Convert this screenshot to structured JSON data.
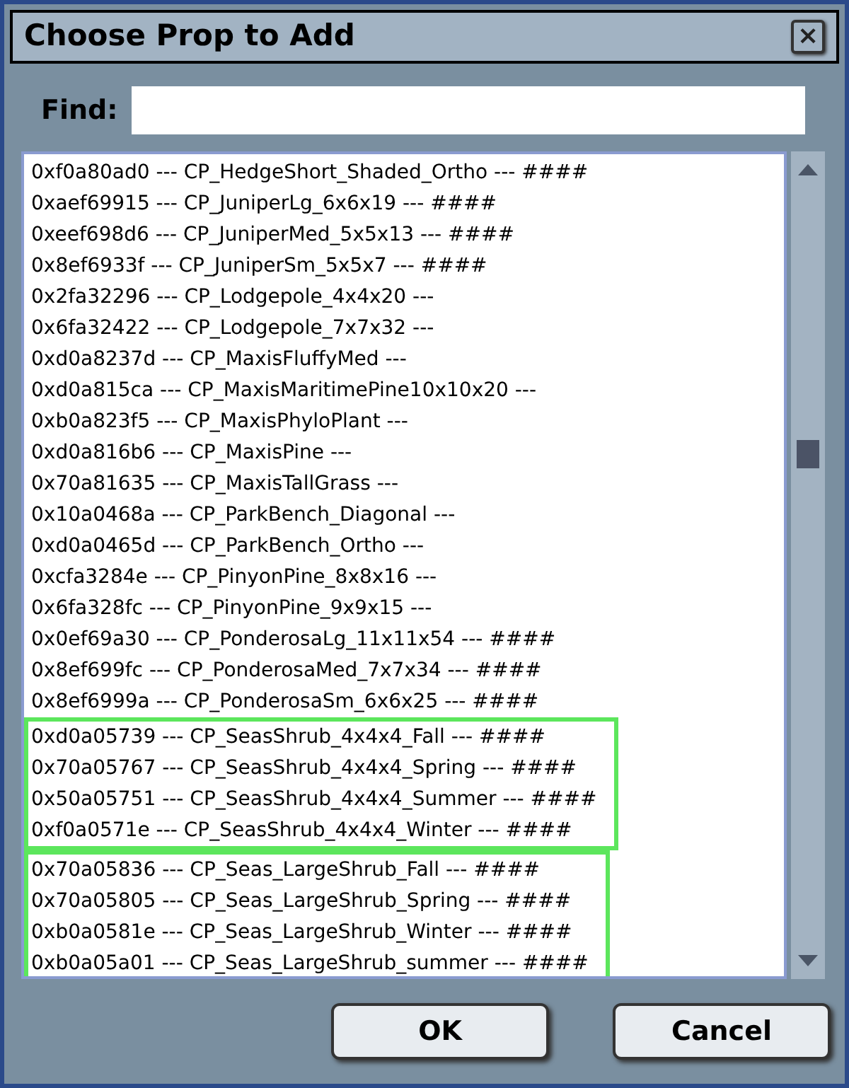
{
  "window": {
    "title": "Choose Prop to Add",
    "close": "×"
  },
  "find": {
    "label": "Find:"
  },
  "list": {
    "groups": [
      {
        "highlighted": false,
        "rows": [
          "0xf0a80ad0 --- CP_HedgeShort_Shaded_Ortho --- ####",
          "0xaef69915 --- CP_JuniperLg_6x6x19 --- ####",
          "0xeef698d6 --- CP_JuniperMed_5x5x13 --- ####",
          "0x8ef6933f --- CP_JuniperSm_5x5x7 --- ####",
          "0x2fa32296 --- CP_Lodgepole_4x4x20 ---",
          "0x6fa32422 --- CP_Lodgepole_7x7x32 ---",
          "0xd0a8237d --- CP_MaxisFluffyMed ---",
          "0xd0a815ca --- CP_MaxisMaritimePine10x10x20 ---",
          "0xb0a823f5 --- CP_MaxisPhyloPlant ---",
          "0xd0a816b6 --- CP_MaxisPine ---",
          "0x70a81635 --- CP_MaxisTallGrass ---",
          "0x10a0468a --- CP_ParkBench_Diagonal ---",
          "0xd0a0465d --- CP_ParkBench_Ortho ---",
          "0xcfa3284e --- CP_PinyonPine_8x8x16 ---",
          "0x6fa328fc --- CP_PinyonPine_9x9x15 ---",
          "0x0ef69a30 --- CP_PonderosaLg_11x11x54 --- ####",
          "0x8ef699fc --- CP_PonderosaMed_7x7x34 --- ####",
          "0x8ef6999a --- CP_PonderosaSm_6x6x25 --- ####"
        ]
      },
      {
        "highlighted": true,
        "rows": [
          "0xd0a05739 --- CP_SeasShrub_4x4x4_Fall --- ####",
          "0x70a05767 --- CP_SeasShrub_4x4x4_Spring --- ####",
          "0x50a05751 --- CP_SeasShrub_4x4x4_Summer --- ####",
          "0xf0a0571e --- CP_SeasShrub_4x4x4_Winter --- ####"
        ]
      },
      {
        "highlighted": true,
        "rows": [
          "0x70a05836 --- CP_Seas_LargeShrub_Fall --- ####",
          "0x70a05805 --- CP_Seas_LargeShrub_Spring --- ####",
          "0xb0a0581e --- CP_Seas_LargeShrub_Winter --- ####",
          "0xb0a05a01 --- CP_Seas_LargeShrub_summer --- ####"
        ]
      }
    ]
  },
  "buttons": [
    {
      "label": "OK"
    },
    {
      "label": "Cancel"
    }
  ]
}
